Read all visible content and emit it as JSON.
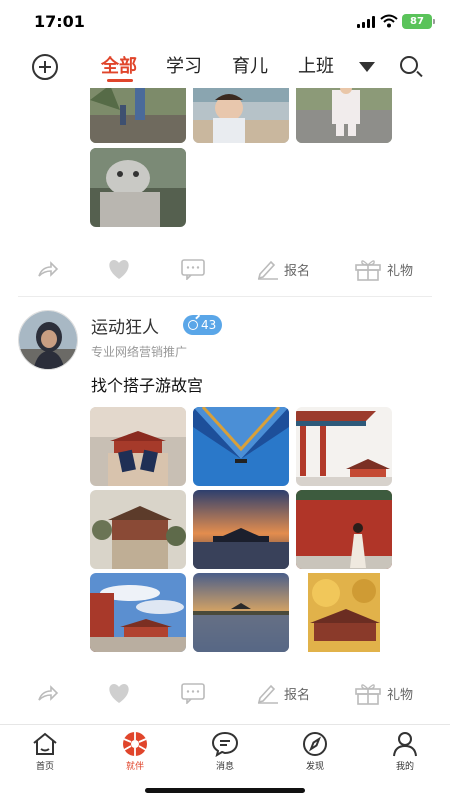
{
  "status_bar": {
    "time": "17:01",
    "battery": "87"
  },
  "top_nav": {
    "tabs": [
      {
        "label": "全部",
        "active": true
      },
      {
        "label": "学习",
        "active": false
      },
      {
        "label": "育儿",
        "active": false
      },
      {
        "label": "上班",
        "active": false
      }
    ]
  },
  "actions": {
    "signup_label": "报名",
    "gift_label": "礼物"
  },
  "post2": {
    "username": "运动狂人",
    "age": "43",
    "subtitle": "专业网络营销推广",
    "text": "找个搭子游故宫"
  },
  "bottom_tabs": [
    {
      "label": "首页",
      "icon": "home-icon",
      "active": false
    },
    {
      "label": "就伴",
      "icon": "aperture-icon",
      "active": true
    },
    {
      "label": "消息",
      "icon": "message-icon",
      "active": false
    },
    {
      "label": "发现",
      "icon": "compass-icon",
      "active": false
    },
    {
      "label": "我的",
      "icon": "profile-icon",
      "active": false
    }
  ],
  "colors": {
    "accent": "#e0452b",
    "badge": "#5aa6e8",
    "battery": "#5ac35a"
  }
}
